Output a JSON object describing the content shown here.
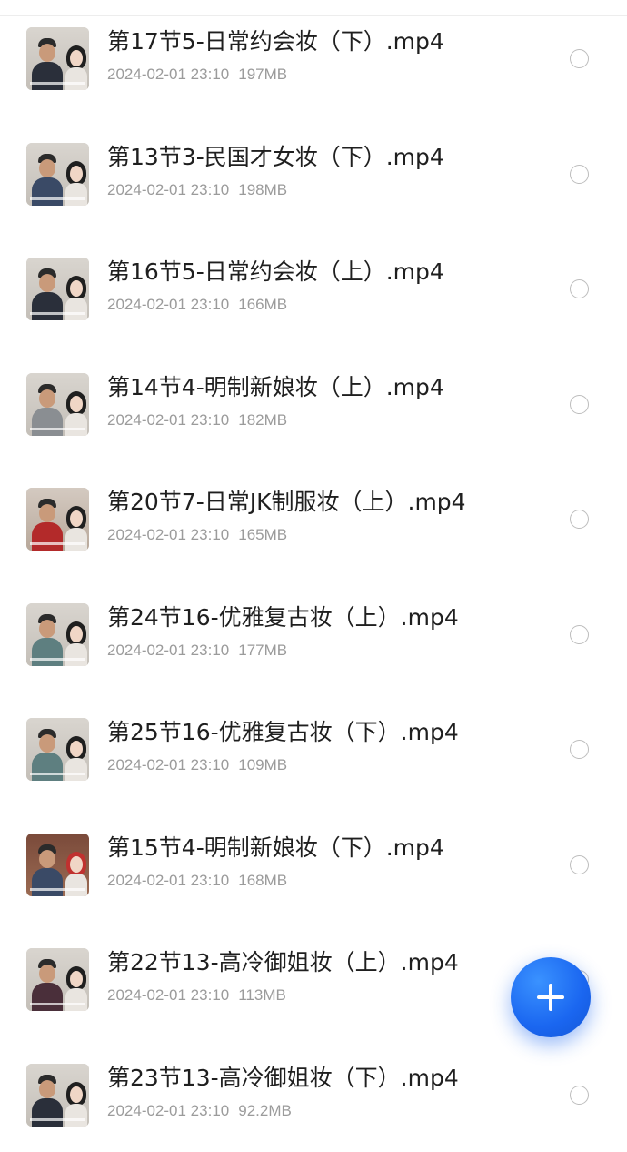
{
  "files": [
    {
      "name": "第17节5-日常约会妆（下）.mp4",
      "date": "2024-02-01 23:10",
      "size": "197MB"
    },
    {
      "name": "第13节3-民国才女妆（下）.mp4",
      "date": "2024-02-01 23:10",
      "size": "198MB"
    },
    {
      "name": "第16节5-日常约会妆（上）.mp4",
      "date": "2024-02-01 23:10",
      "size": "166MB"
    },
    {
      "name": "第14节4-明制新娘妆（上）.mp4",
      "date": "2024-02-01 23:10",
      "size": "182MB"
    },
    {
      "name": "第20节7-日常JK制服妆（上）.mp4",
      "date": "2024-02-01 23:10",
      "size": "165MB"
    },
    {
      "name": "第24节16-优雅复古妆（上）.mp4",
      "date": "2024-02-01 23:10",
      "size": "177MB"
    },
    {
      "name": "第25节16-优雅复古妆（下）.mp4",
      "date": "2024-02-01 23:10",
      "size": "109MB"
    },
    {
      "name": "第15节4-明制新娘妆（下）.mp4",
      "date": "2024-02-01 23:10",
      "size": "168MB"
    },
    {
      "name": "第22节13-高冷御姐妆（上）.mp4",
      "date": "2024-02-01 23:10",
      "size": "113MB"
    },
    {
      "name": "第23节13-高冷御姐妆（下）.mp4",
      "date": "2024-02-01 23:10",
      "size": "92.2MB"
    }
  ],
  "icons": {
    "thumbnail": "video-thumbnail-icon",
    "select": "radio-unselected-icon",
    "fab": "plus-icon"
  },
  "colors": {
    "accent": "#1a66f0",
    "text_primary": "#1f1f1f",
    "text_secondary": "#9b9b9b"
  }
}
